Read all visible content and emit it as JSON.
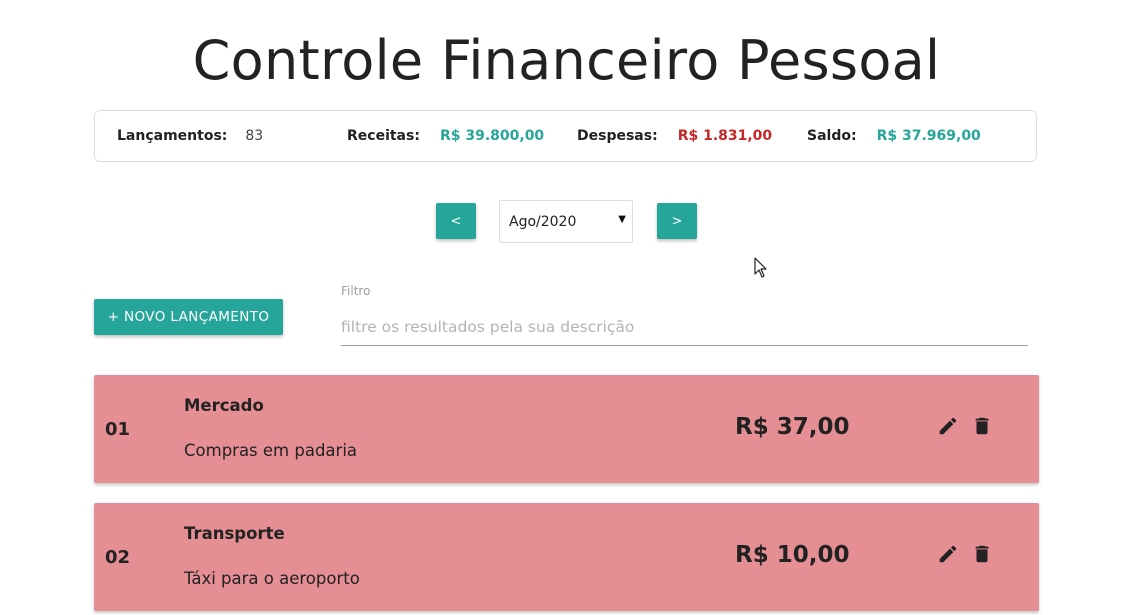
{
  "header": {
    "title": "Controle Financeiro Pessoal"
  },
  "summary": {
    "entries_label": "Lançamentos:",
    "entries_value": "83",
    "income_label": "Receitas:",
    "income_value": "R$ 39.800,00",
    "expense_label": "Despesas:",
    "expense_value": "R$ 1.831,00",
    "balance_label": "Saldo:",
    "balance_value": "R$ 37.969,00",
    "colors": {
      "income": "#26a69a",
      "expense": "#c62828",
      "balance": "#26a69a"
    }
  },
  "period": {
    "prev_label": "<",
    "next_label": ">",
    "selected": "Ago/2020"
  },
  "actions": {
    "new_label": "+ NOVO LANÇAMENTO"
  },
  "filter": {
    "label": "Filtro",
    "placeholder": "filtre os resultados pela sua descrição",
    "value": ""
  },
  "entries": [
    {
      "number": "01",
      "category": "Mercado",
      "description": "Compras em padaria",
      "amount": "R$ 37,00",
      "edit_icon": "pencil-icon",
      "delete_icon": "trash-icon"
    },
    {
      "number": "02",
      "category": "Transporte",
      "description": "Táxi para o aeroporto",
      "amount": "R$ 10,00",
      "edit_icon": "pencil-icon",
      "delete_icon": "trash-icon"
    }
  ],
  "theme": {
    "accent": "#26a69a",
    "expense_row": "#e58e94"
  }
}
